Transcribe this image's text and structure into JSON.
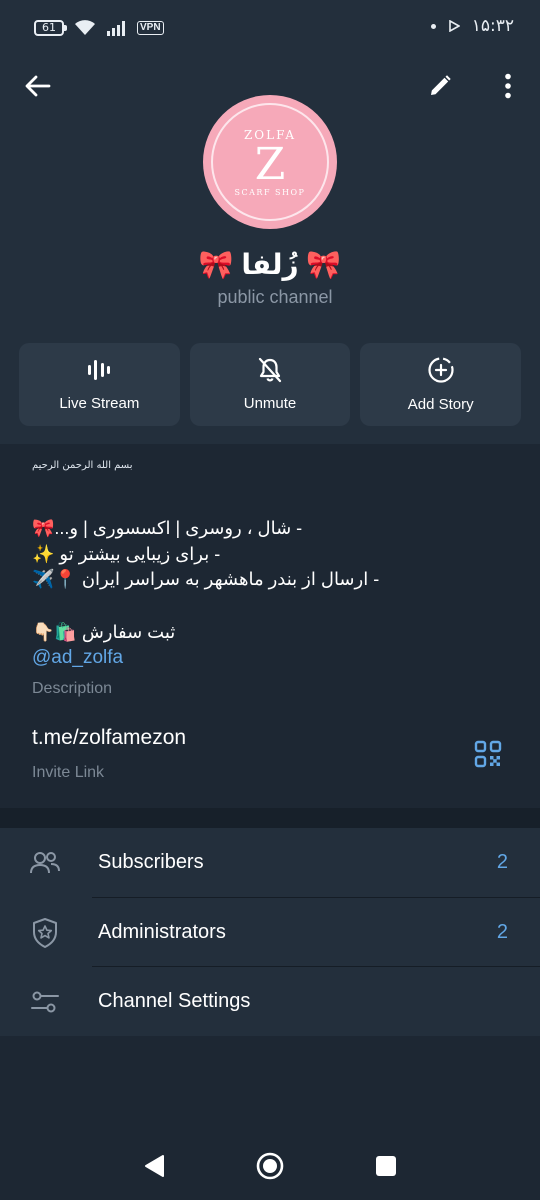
{
  "status_bar": {
    "battery": "61",
    "vpn": "VPN",
    "time": "۱۵:۳۲"
  },
  "header": {
    "avatar_logo": {
      "top_text": "ZOLFA",
      "letter": "Z",
      "bottom_text": "SCARF SHOP"
    },
    "channel_name": "🎀 زُلفا 🎀",
    "channel_type": "public channel"
  },
  "actions": [
    {
      "label": "Live Stream",
      "icon": "live-stream-icon"
    },
    {
      "label": "Unmute",
      "icon": "bell-off-icon"
    },
    {
      "label": "Add Story",
      "icon": "add-story-icon"
    }
  ],
  "info": {
    "basmala": "بسم الله الرحمن الرحیم",
    "description_lines": [
      "- شال ، روسری | اکسسوری | و...🎀",
      "- برای زیبایی بیشتر تو ✨",
      "- ارسال از بندر ماهشهر به سراسر ایران 📍✈️",
      "",
      "ثبت سفارش 🛍️👇🏻"
    ],
    "mention": "@ad_zolfa",
    "description_caption": "Description",
    "invite_link": "t.me/zolfamezon",
    "invite_caption": "Invite Link"
  },
  "list": {
    "rows": [
      {
        "label": "Subscribers",
        "value": "2",
        "icon": "people-icon"
      },
      {
        "label": "Administrators",
        "value": "2",
        "icon": "shield-star-icon"
      },
      {
        "label": "Channel Settings",
        "value": "",
        "icon": "sliders-icon"
      }
    ]
  },
  "colors": {
    "header_bg": "#232f3c",
    "page_bg": "#1d2733",
    "accent": "#62a7e6",
    "button_bg": "#2d3a48",
    "avatar_pink": "#f6a9b9"
  }
}
